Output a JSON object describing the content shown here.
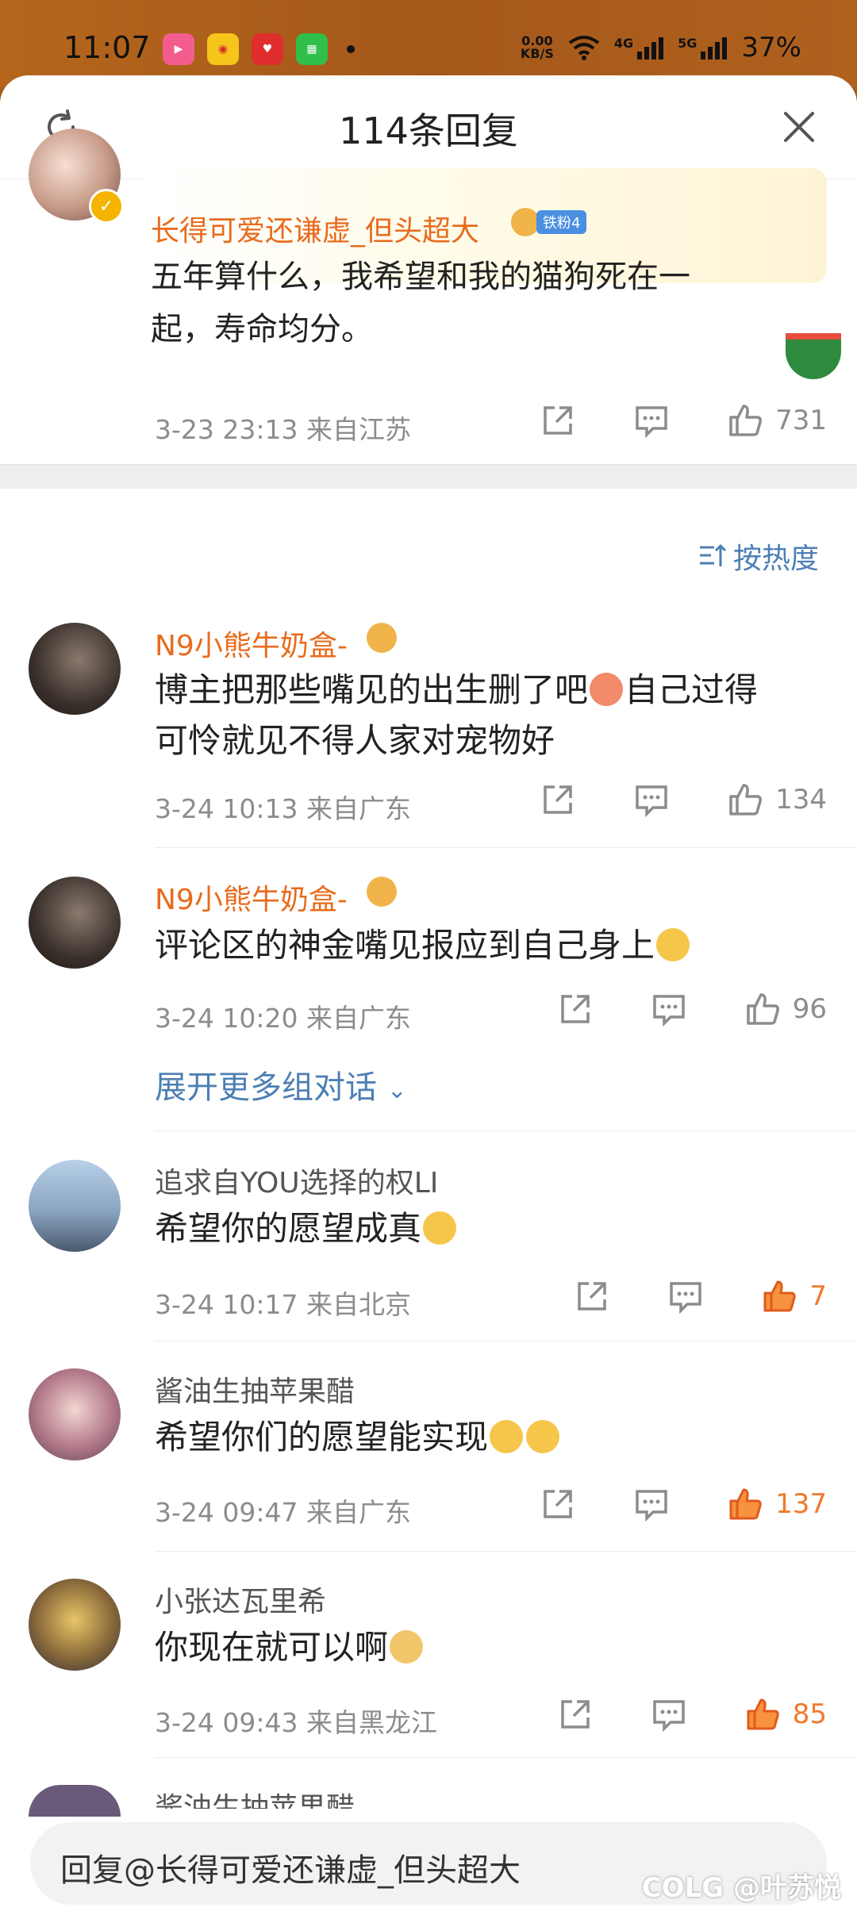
{
  "status_bar": {
    "time": "11:07",
    "net_speed_top": "0.00",
    "net_speed_bottom": "KB/S",
    "network_4g": "4G",
    "network_5g": "5G",
    "battery": "37%",
    "app_icons": [
      "bilibili-icon",
      "weibo-icon",
      "heart-app-icon",
      "green-app-icon"
    ]
  },
  "header": {
    "title": "114条回复"
  },
  "root_comment": {
    "username": "长得可爱还谦虚_但头超大",
    "fan_badge": "铁粉4",
    "text_line1": "五年算什么，我希望和我的猫狗死在一",
    "text_line2": "起，寿命均分。",
    "meta": "3-23 23:13  来自江苏",
    "likes": "731"
  },
  "sort_label": "按热度",
  "replies": [
    {
      "username": "N9小熊牛奶盒-",
      "text_line1": "博主把那些嘴见的出生删了吧",
      "text_line1_after": "自己过得",
      "text_line2": "可怜就见不得人家对宠物好",
      "meta": "3-24 10:13  来自广东",
      "likes": "134",
      "liked": false
    },
    {
      "username": "N9小熊牛奶盒-",
      "text_line1": "评论区的神金嘴见报应到自己身上",
      "meta": "3-24 10:20  来自广东",
      "likes": "96",
      "liked": false
    },
    {
      "username": "追求自YOU选择的权LI",
      "text_line1": "希望你的愿望成真",
      "meta": "3-24 10:17  来自北京",
      "likes": "7",
      "liked": true
    },
    {
      "username": "酱油生抽苹果醋",
      "text_line1": "希望你们的愿望能实现",
      "meta": "3-24 09:47  来自广东",
      "likes": "137",
      "liked": true
    },
    {
      "username": "小张达瓦里希",
      "text_line1": "你现在就可以啊",
      "meta": "3-24 09:43  来自黑龙江",
      "likes": "85",
      "liked": true
    },
    {
      "username": "酱油生抽苹果醋"
    }
  ],
  "expand_label": "展开更多组对话",
  "reply_input": {
    "placeholder": "回复@长得可爱还谦虚_但头超大"
  },
  "watermark": "COLG @叶苏悦",
  "colors": {
    "accent_orange": "#e86b1c",
    "link_blue": "#4d7fb4",
    "like_active": "#f07a2a"
  }
}
